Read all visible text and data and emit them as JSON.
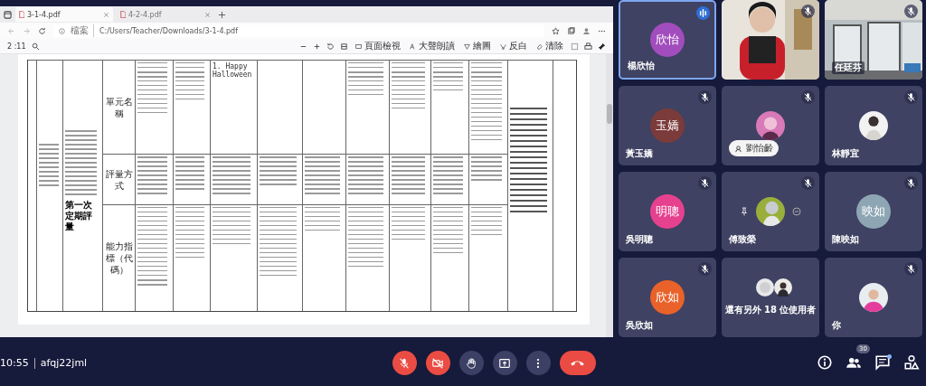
{
  "shared_screen": {
    "tabs": [
      {
        "title": "3-1-4.pdf",
        "selected": true
      },
      {
        "title": "4-2-4.pdf",
        "selected": false
      }
    ],
    "address": {
      "label": "檔案",
      "path": "C:/Users/Teacher/Downloads/3-1-4.pdf"
    },
    "pdf_toolbar": {
      "page": "2 :11",
      "tools": [
        {
          "kind": "page-view",
          "label": "頁面檢視"
        },
        {
          "kind": "read-aloud",
          "label": "大聲朗讀"
        },
        {
          "kind": "draw",
          "label": "繪圖"
        },
        {
          "kind": "highlight",
          "label": "反白"
        },
        {
          "kind": "erase",
          "label": "清除"
        }
      ]
    },
    "table": {
      "schedule_note": "第一次定期評量",
      "rows": [
        {
          "label": "單元名稱",
          "cells": [
            {
              "kind": "illegible"
            },
            {
              "kind": "illegible"
            },
            {
              "kind": "text",
              "text": "1. Happy Halloween"
            },
            {
              "kind": "empty"
            },
            {
              "kind": "empty"
            },
            {
              "kind": "illegible"
            },
            {
              "kind": "illegible"
            },
            {
              "kind": "illegible"
            },
            {
              "kind": "illegible"
            }
          ]
        },
        {
          "label": "評量方式",
          "cells": [
            {
              "kind": "illegible"
            },
            {
              "kind": "illegible"
            },
            {
              "kind": "illegible"
            },
            {
              "kind": "illegible"
            },
            {
              "kind": "illegible"
            },
            {
              "kind": "illegible"
            },
            {
              "kind": "illegible"
            },
            {
              "kind": "illegible"
            },
            {
              "kind": "illegible"
            }
          ]
        },
        {
          "label": "能力指標（代碼）",
          "cells": [
            {
              "kind": "illegible"
            },
            {
              "kind": "illegible"
            },
            {
              "kind": "illegible"
            },
            {
              "kind": "illegible"
            },
            {
              "kind": "illegible"
            },
            {
              "kind": "illegible"
            },
            {
              "kind": "illegible"
            },
            {
              "kind": "illegible"
            },
            {
              "kind": "illegible"
            }
          ]
        }
      ]
    }
  },
  "participants": [
    {
      "kind": "initials",
      "name": "楊欣怡",
      "avatar": "欣怡",
      "color": "#a24dbd",
      "muted": false,
      "selected": true
    },
    {
      "kind": "video",
      "muted": true,
      "selected": false
    },
    {
      "kind": "video",
      "name": "任廷芬",
      "muted": true,
      "selected": false
    },
    {
      "kind": "initials",
      "name": "黃玉嬌",
      "avatar": "玉嬌",
      "color": "#7b3b3a",
      "muted": true,
      "selected": false
    },
    {
      "kind": "chip",
      "name": "劉怡齡",
      "muted": true,
      "selected": false
    },
    {
      "kind": "picture",
      "name": "林靜宜",
      "muted": true,
      "selected": false
    },
    {
      "kind": "initials",
      "name": "吳明聰",
      "avatar": "明聰",
      "color": "#e6418f",
      "muted": true,
      "selected": false
    },
    {
      "kind": "hover",
      "name": "傅致榮",
      "muted": true,
      "selected": false
    },
    {
      "kind": "initials",
      "name": "陳映如",
      "avatar": "映如",
      "color": "#8ea6b4",
      "muted": true,
      "selected": false
    },
    {
      "kind": "initials",
      "name": "吳欣如",
      "avatar": "欣如",
      "color": "#e8622a",
      "muted": true,
      "selected": false
    },
    {
      "kind": "others",
      "label": "還有另外 18 位使用者"
    },
    {
      "kind": "picture",
      "name": "你",
      "muted": true,
      "selected": false
    }
  ],
  "bottom_bar": {
    "time": "10:55",
    "meeting_code": "afqj22jml",
    "controls": [
      {
        "kind": "mic",
        "on": false
      },
      {
        "kind": "camera",
        "on": false
      },
      {
        "kind": "hand"
      },
      {
        "kind": "present"
      },
      {
        "kind": "more"
      },
      {
        "kind": "leave"
      }
    ],
    "side_controls": [
      {
        "kind": "info"
      },
      {
        "kind": "people",
        "badge": "30"
      },
      {
        "kind": "chat",
        "unread": true
      },
      {
        "kind": "activities"
      }
    ]
  }
}
